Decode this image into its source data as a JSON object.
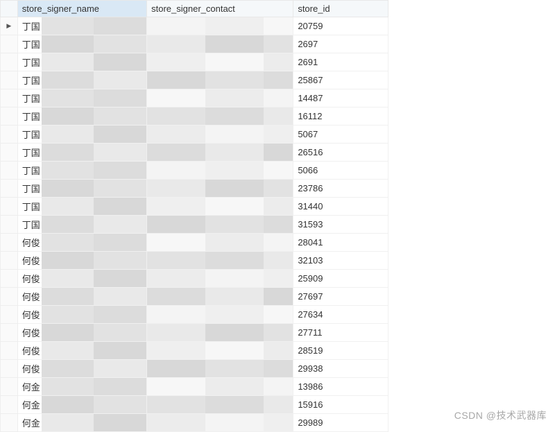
{
  "columns": {
    "name": "store_signer_name",
    "contact": "store_signer_contact",
    "id": "store_id"
  },
  "row_indicator": "▶",
  "rows": [
    {
      "name_prefix": "丁国",
      "id": "20759"
    },
    {
      "name_prefix": "丁国",
      "id": "2697"
    },
    {
      "name_prefix": "丁国",
      "id": "2691"
    },
    {
      "name_prefix": "丁国",
      "id": "25867"
    },
    {
      "name_prefix": "丁国",
      "id": "14487"
    },
    {
      "name_prefix": "丁国",
      "id": "16112"
    },
    {
      "name_prefix": "丁国",
      "id": "5067"
    },
    {
      "name_prefix": "丁国",
      "id": "26516"
    },
    {
      "name_prefix": "丁国",
      "id": "5066"
    },
    {
      "name_prefix": "丁国",
      "id": "23786"
    },
    {
      "name_prefix": "丁国",
      "id": "31440"
    },
    {
      "name_prefix": "丁国",
      "id": "31593"
    },
    {
      "name_prefix": "何俊",
      "id": "28041"
    },
    {
      "name_prefix": "何俊",
      "id": "32103"
    },
    {
      "name_prefix": "何俊",
      "id": "25909"
    },
    {
      "name_prefix": "何俊",
      "id": "27697"
    },
    {
      "name_prefix": "何俊",
      "id": "27634"
    },
    {
      "name_prefix": "何俊",
      "id": "27711"
    },
    {
      "name_prefix": "何俊",
      "id": "28519"
    },
    {
      "name_prefix": "何俊",
      "id": "29938"
    },
    {
      "name_prefix": "何金",
      "id": "13986"
    },
    {
      "name_prefix": "何金",
      "id": "15916"
    },
    {
      "name_prefix": "何金",
      "id": "29989"
    }
  ],
  "censor_shades": [
    "#e2e2e2",
    "#f4f4f4",
    "#d8d8d8",
    "#ececec",
    "#e9e9e9",
    "#f7f7f7",
    "#dcdcdc",
    "#efefef"
  ],
  "watermark": "CSDN @技术武器库"
}
